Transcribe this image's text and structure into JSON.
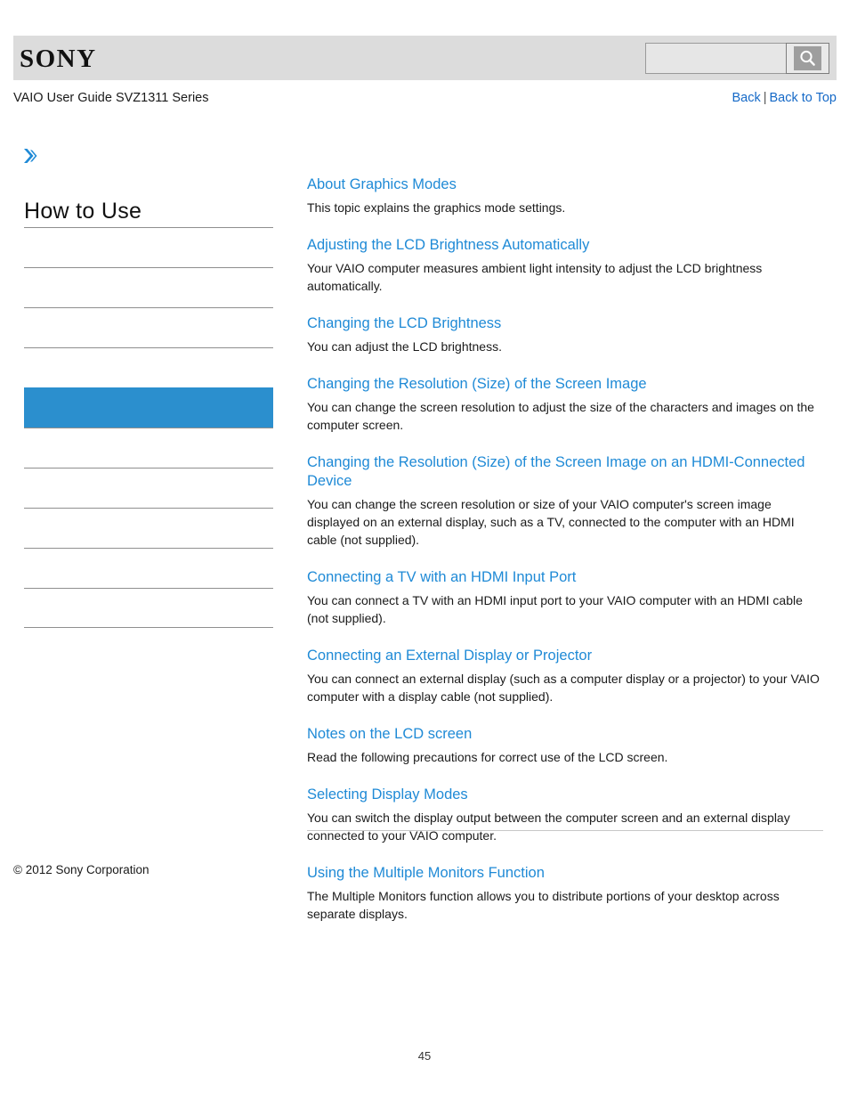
{
  "header": {
    "logo_text": "SONY",
    "search": {
      "value": "",
      "placeholder": "",
      "icon": "search-icon",
      "button_label": ""
    }
  },
  "subheader": {
    "guide_title": "VAIO User Guide SVZ1311 Series",
    "back_label": "Back",
    "separator": "|",
    "back_to_top_label": "Back to Top"
  },
  "sidebar": {
    "breadcrumb_icon": "double-chevron-right-icon",
    "section_title": "How to Use",
    "accent_color": "#2b8fce",
    "items": [
      {
        "label": "",
        "active": false
      },
      {
        "label": "",
        "active": false
      },
      {
        "label": "",
        "active": false
      },
      {
        "label": "",
        "active": false
      },
      {
        "label": "",
        "active": true
      },
      {
        "label": "",
        "active": false
      },
      {
        "label": "",
        "active": false
      },
      {
        "label": "",
        "active": false
      },
      {
        "label": "",
        "active": false
      },
      {
        "label": "",
        "active": false
      }
    ]
  },
  "main": {
    "topics": [
      {
        "title": "About Graphics Modes",
        "description": "This topic explains the graphics mode settings."
      },
      {
        "title": "Adjusting the LCD Brightness Automatically",
        "description": "Your VAIO computer measures ambient light intensity to adjust the LCD brightness automatically."
      },
      {
        "title": "Changing the LCD Brightness",
        "description": "You can adjust the LCD brightness."
      },
      {
        "title": "Changing the Resolution (Size) of the Screen Image",
        "description": "You can change the screen resolution to adjust the size of the characters and images on the computer screen."
      },
      {
        "title": "Changing the Resolution (Size) of the Screen Image on an HDMI-Connected Device",
        "description": "You can change the screen resolution or size of your VAIO computer's screen image displayed on an external display, such as a TV, connected to the computer with an HDMI cable (not supplied)."
      },
      {
        "title": "Connecting a TV with an HDMI Input Port",
        "description": "You can connect a TV with an HDMI input port to your VAIO computer with an HDMI cable (not supplied)."
      },
      {
        "title": "Connecting an External Display or Projector",
        "description": "You can connect an external display (such as a computer display or a projector) to your VAIO computer with a display cable (not supplied)."
      },
      {
        "title": "Notes on the LCD screen",
        "description": "Read the following precautions for correct use of the LCD screen."
      },
      {
        "title": "Selecting Display Modes",
        "description": "You can switch the display output between the computer screen and an external display connected to your VAIO computer."
      },
      {
        "title": "Using the Multiple Monitors Function",
        "description": "The Multiple Monitors function allows you to distribute portions of your desktop across separate displays."
      }
    ]
  },
  "footer": {
    "copyright": "© 2012 Sony Corporation",
    "page_number": "45"
  }
}
